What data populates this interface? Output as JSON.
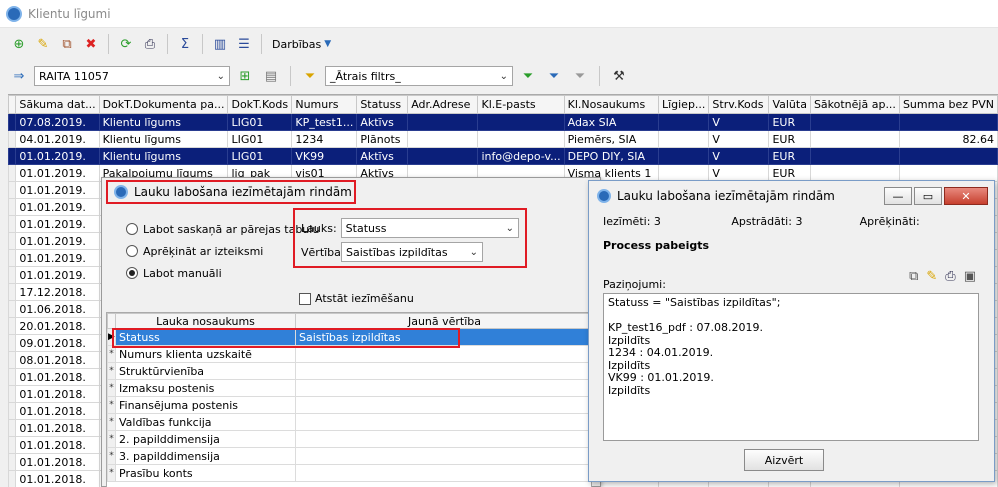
{
  "app": {
    "title": "Klientu līgumi"
  },
  "toolbar": {
    "actions_label": "Darbības"
  },
  "filter": {
    "view": "RAITA 11057",
    "quick_filter": "_Ātrais filtrs_"
  },
  "grid": {
    "columns": [
      "Sākuma dat...",
      "DokT.Dokumenta pa...",
      "DokT.Kods",
      "Numurs",
      "Statuss",
      "Adr.Adrese",
      "Kl.E-pasts",
      "Kl.Nosaukums",
      "Līgiep...",
      "Strv.Kods",
      "Valūta",
      "Sākotnējā ap...",
      "Summa bez PVN"
    ],
    "rows": [
      [
        "07.08.2019.",
        "Klientu līgums",
        "LIG01",
        "KP_test1...",
        "Aktīvs",
        "",
        "",
        "Adax SIA",
        "",
        "V",
        "EUR",
        "",
        ""
      ],
      [
        "04.01.2019.",
        "Klientu līgums",
        "LIG01",
        "1234",
        "Plānots",
        "",
        "",
        "Piemērs, SIA",
        "",
        "V",
        "EUR",
        "",
        "82.64"
      ],
      [
        "01.01.2019.",
        "Klientu līgums",
        "LIG01",
        "VK99",
        "Aktīvs",
        "",
        "info@depo-v...",
        "DEPO DIY, SIA",
        "",
        "V",
        "EUR",
        "",
        ""
      ],
      [
        "01.01.2019.",
        "Pakalpojumu līgums",
        "lig_pak",
        "vis01",
        "Aktīvs",
        "",
        "",
        "Visma klients 1",
        "",
        "V",
        "EUR",
        "",
        ""
      ],
      [
        "01.01.2019.",
        "",
        "",
        "",
        "",
        "",
        "",
        "",
        "",
        "",
        "",
        "",
        ""
      ],
      [
        "01.01.2019.",
        "",
        "",
        "",
        "",
        "",
        "",
        "",
        "",
        "",
        "",
        "",
        ""
      ],
      [
        "01.01.2019.",
        "",
        "",
        "",
        "",
        "",
        "",
        "",
        "",
        "",
        "",
        "",
        ""
      ],
      [
        "01.01.2019.",
        "",
        "",
        "",
        "",
        "",
        "",
        "",
        "",
        "",
        "",
        "",
        ""
      ],
      [
        "01.01.2019.",
        "",
        "",
        "",
        "",
        "",
        "",
        "",
        "",
        "",
        "",
        "",
        ""
      ],
      [
        "01.01.2019.",
        "",
        "",
        "",
        "",
        "",
        "",
        "",
        "",
        "",
        "",
        "",
        ""
      ],
      [
        "17.12.2018.",
        "",
        "",
        "",
        "",
        "",
        "",
        "",
        "",
        "",
        "",
        "",
        ""
      ],
      [
        "01.06.2018.",
        "",
        "",
        "",
        "",
        "",
        "",
        "",
        "",
        "",
        "",
        "",
        ""
      ],
      [
        "20.01.2018.",
        "",
        "",
        "",
        "",
        "",
        "",
        "",
        "",
        "",
        "",
        "",
        ""
      ],
      [
        "09.01.2018.",
        "",
        "",
        "",
        "",
        "",
        "",
        "",
        "",
        "",
        "",
        "",
        ""
      ],
      [
        "08.01.2018.",
        "",
        "",
        "",
        "",
        "",
        "",
        "",
        "",
        "",
        "",
        "",
        ""
      ],
      [
        "01.01.2018.",
        "",
        "",
        "",
        "",
        "",
        "",
        "",
        "",
        "",
        "",
        "",
        ""
      ],
      [
        "01.01.2018.",
        "",
        "",
        "",
        "",
        "",
        "",
        "",
        "",
        "",
        "",
        "",
        ""
      ],
      [
        "01.01.2018.",
        "",
        "",
        "",
        "",
        "",
        "",
        "",
        "",
        "",
        "",
        "",
        ""
      ],
      [
        "01.01.2018.",
        "",
        "",
        "",
        "",
        "",
        "",
        "",
        "",
        "",
        "",
        "",
        ""
      ],
      [
        "01.01.2018.",
        "",
        "",
        "",
        "",
        "",
        "",
        "",
        "",
        "",
        "",
        "",
        ""
      ],
      [
        "01.01.2018.",
        "",
        "",
        "",
        "",
        "",
        "",
        "",
        "",
        "",
        "",
        "",
        ""
      ],
      [
        "01.01.2018.",
        "",
        "",
        "",
        "",
        "",
        "",
        "",
        "",
        "",
        "",
        "",
        ""
      ],
      [
        "01.01.2018.",
        "",
        "",
        "",
        "",
        "",
        "",
        "",
        "",
        "",
        "",
        "",
        ""
      ]
    ]
  },
  "dialog1": {
    "title": "Lauku labošana iezīmētajām rindām",
    "radio1": "Labot saskaņā ar pārejas tabulu",
    "radio2": "Aprēķināt ar izteiksmi",
    "radio3": "Labot manuāli",
    "field_label": "Lauks:",
    "field_value": "Statuss",
    "value_label": "Vērtība",
    "value_value": "Saistības izpildītas",
    "keep_selection": "Atstāt iezīmēšanu",
    "col_name": "Lauka nosaukums",
    "col_new": "Jaunā vērtība",
    "rows": [
      {
        "name": "Statuss",
        "value": "Saistības izpildītas"
      },
      {
        "name": "Numurs klienta uzskaitē",
        "value": ""
      },
      {
        "name": "Struktūrvienība",
        "value": ""
      },
      {
        "name": "Izmaksu postenis",
        "value": ""
      },
      {
        "name": "Finansējuma postenis",
        "value": ""
      },
      {
        "name": "Valdības funkcija",
        "value": ""
      },
      {
        "name": "2. papilddimensija",
        "value": ""
      },
      {
        "name": "3. papilddimensija",
        "value": ""
      },
      {
        "name": "Prasību konts",
        "value": ""
      }
    ]
  },
  "dialog2": {
    "title": "Lauku labošana iezīmētajām rindām",
    "marked": "Iezīmēti: 3",
    "processed": "Apstrādāti: 3",
    "calculated": "Aprēķināti:",
    "done": "Process pabeigts",
    "messages_label": "Paziņojumi:",
    "messages": "Statuss = \"Saistības izpildītas\";\n\nKP_test16_pdf : 07.08.2019.\nIzpildīts\n1234 : 04.01.2019.\nIzpildīts\nVK99 : 01.01.2019.\nIzpildīts",
    "close": "Aizvērt"
  },
  "colors": {
    "selected_row": "#0b1f7a",
    "highlight": "#e01b24",
    "subgrid_selected": "#3080d8"
  }
}
